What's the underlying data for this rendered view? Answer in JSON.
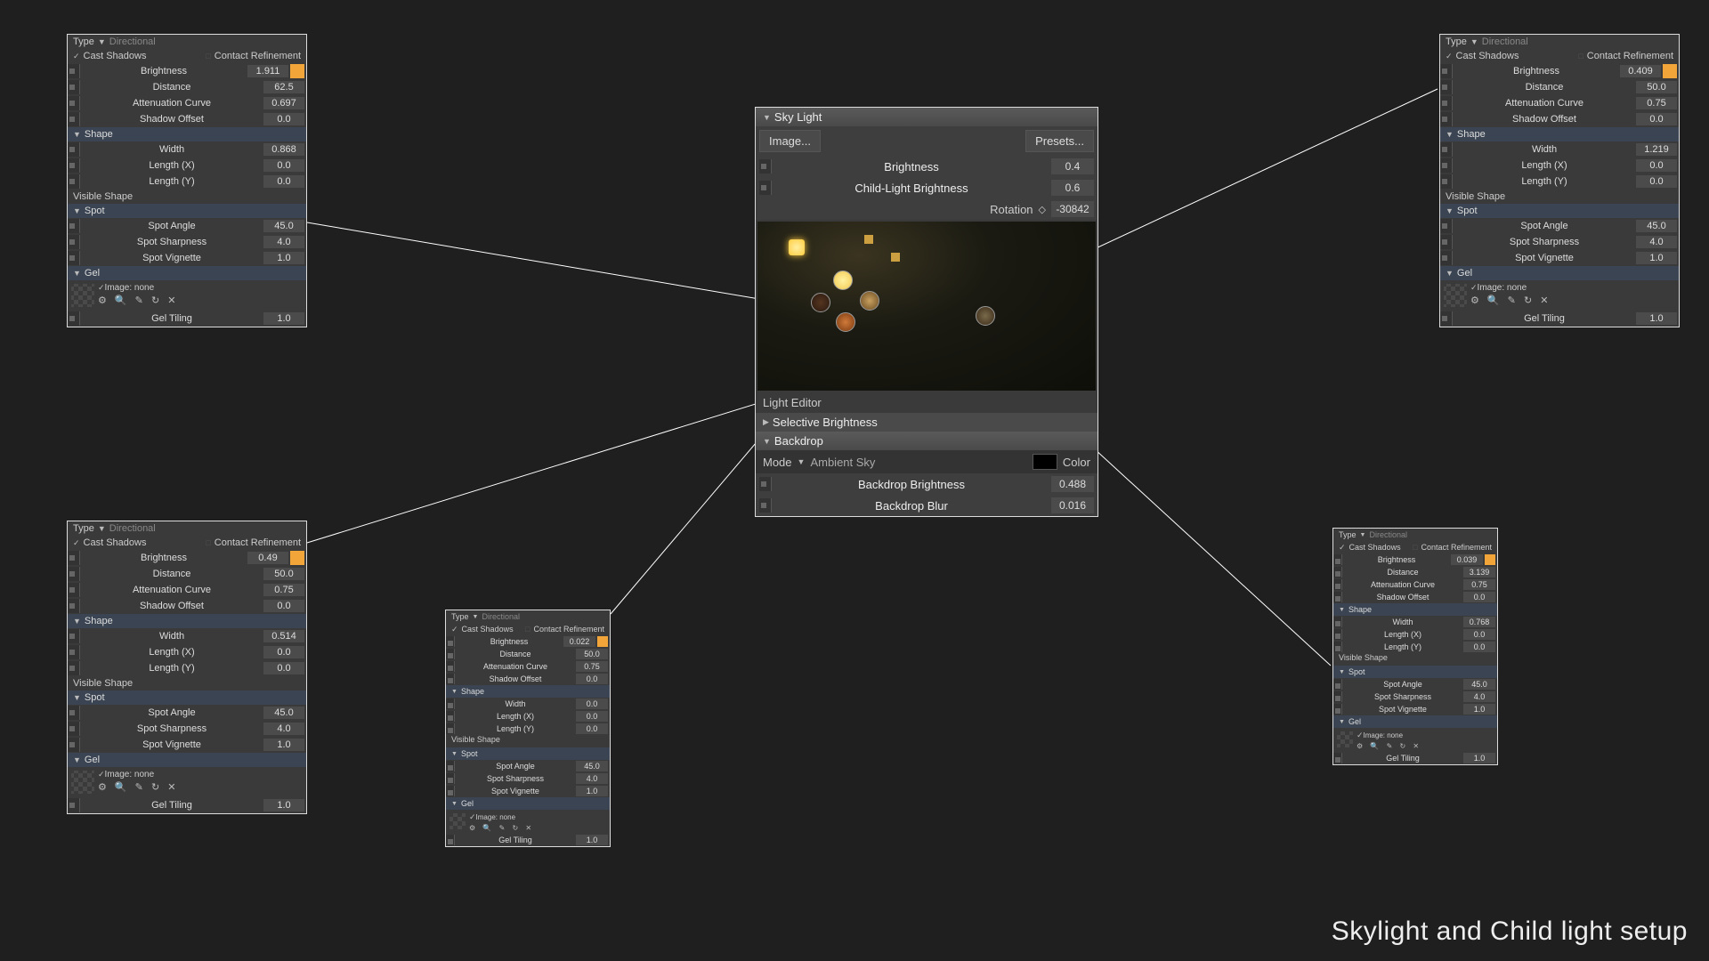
{
  "caption": "Skylight and Child light setup",
  "labels": {
    "type": "Type",
    "directional": "Directional",
    "cast_shadows": "Cast Shadows",
    "contact_refinement": "Contact Refinement",
    "brightness": "Brightness",
    "distance": "Distance",
    "attenuation": "Attenuation Curve",
    "shadow_offset": "Shadow Offset",
    "shape": "Shape",
    "width": "Width",
    "length_x": "Length (X)",
    "length_y": "Length (Y)",
    "visible_shape": "Visible Shape",
    "spot": "Spot",
    "spot_angle": "Spot Angle",
    "spot_sharpness": "Spot Sharpness",
    "spot_vignette": "Spot Vignette",
    "gel": "Gel",
    "image_none": "Image: none",
    "gel_tiling": "Gel Tiling"
  },
  "sky": {
    "title": "Sky Light",
    "image_btn": "Image...",
    "presets_btn": "Presets...",
    "brightness_label": "Brightness",
    "brightness": "0.4",
    "child_brightness_label": "Child-Light Brightness",
    "child_brightness": "0.6",
    "rotation_label": "Rotation",
    "rotation": "-30842",
    "light_editor": "Light Editor",
    "selective_brightness": "Selective Brightness",
    "backdrop": "Backdrop",
    "mode": "Mode",
    "ambient_sky": "Ambient Sky",
    "color": "Color",
    "backdrop_brightness_label": "Backdrop Brightness",
    "backdrop_brightness": "0.488",
    "backdrop_blur_label": "Backdrop Blur",
    "backdrop_blur": "0.016"
  },
  "lights": {
    "tl": {
      "brightness": "1.911",
      "distance": "62.5",
      "attenuation": "0.697",
      "shadow_offset": "0.0",
      "width": "0.868",
      "length_x": "0.0",
      "length_y": "0.0",
      "spot_angle": "45.0",
      "spot_sharpness": "4.0",
      "spot_vignette": "1.0",
      "gel_tiling": "1.0"
    },
    "bl": {
      "brightness": "0.49",
      "distance": "50.0",
      "attenuation": "0.75",
      "shadow_offset": "0.0",
      "width": "0.514",
      "length_x": "0.0",
      "length_y": "0.0",
      "spot_angle": "45.0",
      "spot_sharpness": "4.0",
      "spot_vignette": "1.0",
      "gel_tiling": "1.0"
    },
    "bm": {
      "brightness": "0.022",
      "distance": "50.0",
      "attenuation": "0.75",
      "shadow_offset": "0.0",
      "width": "0.0",
      "length_x": "0.0",
      "length_y": "0.0",
      "spot_angle": "45.0",
      "spot_sharpness": "4.0",
      "spot_vignette": "1.0",
      "gel_tiling": "1.0"
    },
    "tr": {
      "brightness": "0.409",
      "distance": "50.0",
      "attenuation": "0.75",
      "shadow_offset": "0.0",
      "width": "1.219",
      "length_x": "0.0",
      "length_y": "0.0",
      "spot_angle": "45.0",
      "spot_sharpness": "4.0",
      "spot_vignette": "1.0",
      "gel_tiling": "1.0"
    },
    "br": {
      "brightness": "0.039",
      "distance": "3.139",
      "attenuation": "0.75",
      "shadow_offset": "0.0",
      "width": "0.768",
      "length_x": "0.0",
      "length_y": "0.0",
      "spot_angle": "45.0",
      "spot_sharpness": "4.0",
      "spot_vignette": "1.0",
      "gel_tiling": "1.0"
    }
  }
}
